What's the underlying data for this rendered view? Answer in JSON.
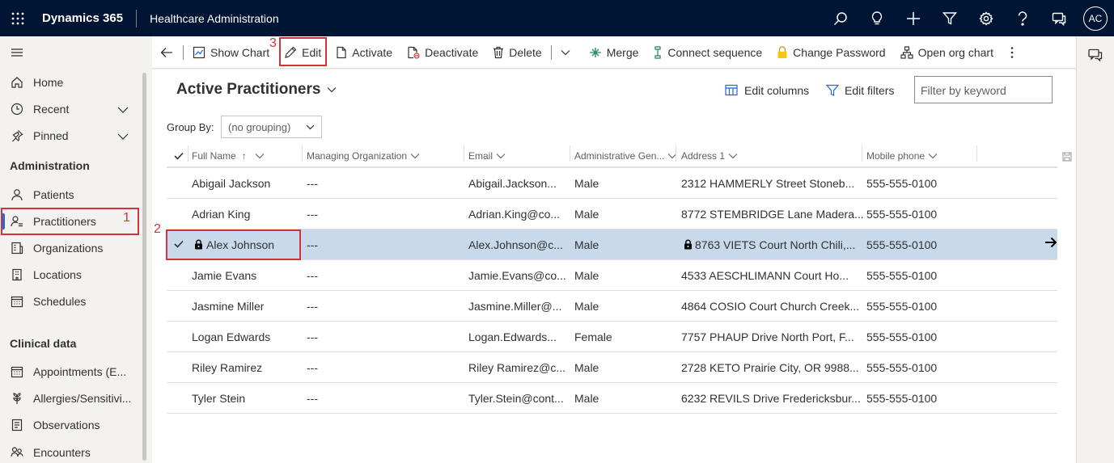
{
  "topbar": {
    "app_name": "Dynamics 365",
    "module_name": "Healthcare Administration",
    "avatar_initials": "AC"
  },
  "sidebar": {
    "items": [
      {
        "label": "Home"
      },
      {
        "label": "Recent"
      },
      {
        "label": "Pinned"
      }
    ],
    "sections": [
      {
        "title": "Administration",
        "items": [
          "Patients",
          "Practitioners",
          "Organizations",
          "Locations",
          "Schedules"
        ]
      },
      {
        "title": "Clinical data",
        "items": [
          "Appointments (E...",
          "Allergies/Sensitivi...",
          "Observations",
          "Encounters"
        ]
      }
    ]
  },
  "annotations": [
    "1",
    "2",
    "3"
  ],
  "commands": {
    "show_chart": "Show Chart",
    "edit": "Edit",
    "activate": "Activate",
    "deactivate": "Deactivate",
    "delete": "Delete",
    "merge": "Merge",
    "connect_sequence": "Connect sequence",
    "change_password": "Change Password",
    "open_org_chart": "Open org chart"
  },
  "view": {
    "title": "Active Practitioners",
    "edit_columns": "Edit columns",
    "edit_filters": "Edit filters",
    "filter_placeholder": "Filter by keyword",
    "group_by_label": "Group By:",
    "group_by_value": "(no grouping)"
  },
  "grid": {
    "columns": [
      "Full Name",
      "Managing Organization",
      "Email",
      "Administrative Gen...",
      "Address 1",
      "Mobile phone"
    ],
    "sort_indicator": "↑",
    "rows": [
      {
        "name": "Abigail Jackson",
        "org": "---",
        "email": "Abigail.Jackson...",
        "gender": "Male",
        "address": "2312 HAMMERLY Street Stoneb...",
        "phone": "555-555-0100"
      },
      {
        "name": "Adrian King",
        "org": "---",
        "email": "Adrian.King@co...",
        "gender": "Male",
        "address": "8772 STEMBRIDGE Lane Madera...",
        "phone": "555-555-0100"
      },
      {
        "name": "Alex Johnson",
        "org": "---",
        "email": "Alex.Johnson@c...",
        "gender": "Male",
        "address": "8763 VIETS Court North Chili,...",
        "phone": "555-555-0100",
        "selected": true
      },
      {
        "name": "Jamie Evans",
        "org": "---",
        "email": "Jamie.Evans@co...",
        "gender": "Male",
        "address": "4533 AESCHLIMANN Court Ho...",
        "phone": "555-555-0100"
      },
      {
        "name": "Jasmine Miller",
        "org": "---",
        "email": "Jasmine.Miller@...",
        "gender": "Male",
        "address": "4864 COSIO Court Church Creek...",
        "phone": "555-555-0100"
      },
      {
        "name": "Logan Edwards",
        "org": "---",
        "email": "Logan.Edwards...",
        "gender": "Female",
        "address": "7757 PHAUP Drive North Port, F...",
        "phone": "555-555-0100"
      },
      {
        "name": "Riley Ramirez",
        "org": "---",
        "email": "Riley Ramirez@c...",
        "gender": "Male",
        "address": "2728 KETO Prairie City, OR 9988...",
        "phone": "555-555-0100"
      },
      {
        "name": "Tyler Stein",
        "org": "---",
        "email": "Tyler.Stein@cont...",
        "gender": "Male",
        "address": "6232 REVILS Drive Fredericksbur...",
        "phone": "555-555-0100"
      }
    ]
  }
}
